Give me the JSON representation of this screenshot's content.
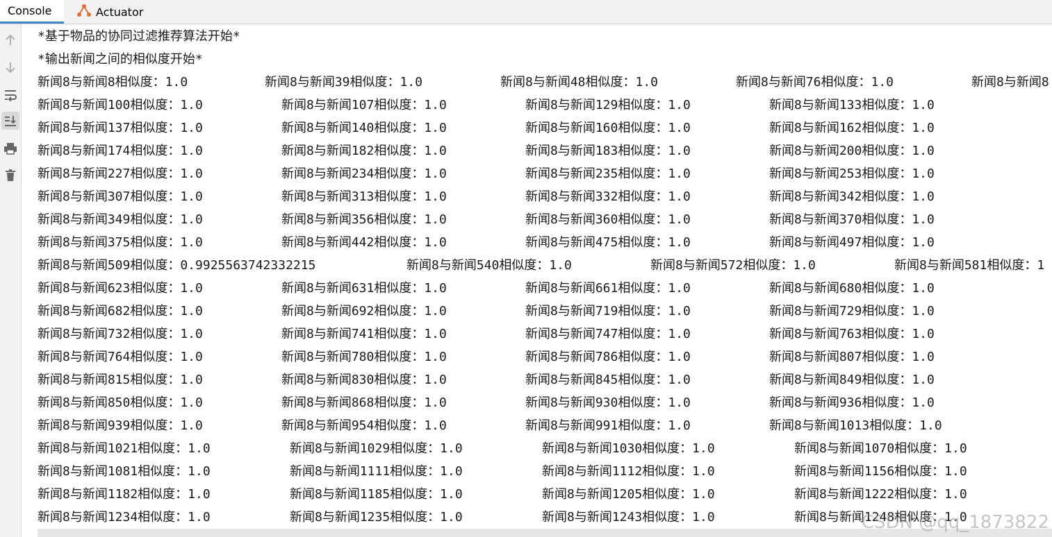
{
  "tabs": {
    "console": "Console",
    "actuator": "Actuator"
  },
  "toolbar_icons": [
    "arrow-up-icon",
    "arrow-down-icon",
    "soft-wrap-icon",
    "scroll-to-end-icon",
    "print-icon",
    "trash-icon"
  ],
  "header_lines": [
    "*基于物品的协同过滤推荐算法开始*",
    "*输出新闻之间的相似度开始*"
  ],
  "rows": [
    [
      "新闻8与新闻8相似度：1.0",
      "新闻8与新闻39相似度：1.0",
      "新闻8与新闻48相似度：1.0",
      "新闻8与新闻76相似度：1.0",
      "新闻8与新闻8"
    ],
    [
      "新闻8与新闻100相似度：1.0",
      "新闻8与新闻107相似度：1.0",
      "新闻8与新闻129相似度：1.0",
      "新闻8与新闻133相似度：1.0"
    ],
    [
      "新闻8与新闻137相似度：1.0",
      "新闻8与新闻140相似度：1.0",
      "新闻8与新闻160相似度：1.0",
      "新闻8与新闻162相似度：1.0"
    ],
    [
      "新闻8与新闻174相似度：1.0",
      "新闻8与新闻182相似度：1.0",
      "新闻8与新闻183相似度：1.0",
      "新闻8与新闻200相似度：1.0"
    ],
    [
      "新闻8与新闻227相似度：1.0",
      "新闻8与新闻234相似度：1.0",
      "新闻8与新闻235相似度：1.0",
      "新闻8与新闻253相似度：1.0"
    ],
    [
      "新闻8与新闻307相似度：1.0",
      "新闻8与新闻313相似度：1.0",
      "新闻8与新闻332相似度：1.0",
      "新闻8与新闻342相似度：1.0"
    ],
    [
      "新闻8与新闻349相似度：1.0",
      "新闻8与新闻356相似度：1.0",
      "新闻8与新闻360相似度：1.0",
      "新闻8与新闻370相似度：1.0"
    ],
    [
      "新闻8与新闻375相似度：1.0",
      "新闻8与新闻442相似度：1.0",
      "新闻8与新闻475相似度：1.0",
      "新闻8与新闻497相似度：1.0"
    ],
    [
      "新闻8与新闻509相似度：0.9925563742332215",
      "新闻8与新闻540相似度：1.0",
      "新闻8与新闻572相似度：1.0",
      "新闻8与新闻581相似度：1"
    ],
    [
      "新闻8与新闻623相似度：1.0",
      "新闻8与新闻631相似度：1.0",
      "新闻8与新闻661相似度：1.0",
      "新闻8与新闻680相似度：1.0"
    ],
    [
      "新闻8与新闻682相似度：1.0",
      "新闻8与新闻692相似度：1.0",
      "新闻8与新闻719相似度：1.0",
      "新闻8与新闻729相似度：1.0"
    ],
    [
      "新闻8与新闻732相似度：1.0",
      "新闻8与新闻741相似度：1.0",
      "新闻8与新闻747相似度：1.0",
      "新闻8与新闻763相似度：1.0"
    ],
    [
      "新闻8与新闻764相似度：1.0",
      "新闻8与新闻780相似度：1.0",
      "新闻8与新闻786相似度：1.0",
      "新闻8与新闻807相似度：1.0"
    ],
    [
      "新闻8与新闻815相似度：1.0",
      "新闻8与新闻830相似度：1.0",
      "新闻8与新闻845相似度：1.0",
      "新闻8与新闻849相似度：1.0"
    ],
    [
      "新闻8与新闻850相似度：1.0",
      "新闻8与新闻868相似度：1.0",
      "新闻8与新闻930相似度：1.0",
      "新闻8与新闻936相似度：1.0"
    ],
    [
      "新闻8与新闻939相似度：1.0",
      "新闻8与新闻954相似度：1.0",
      "新闻8与新闻991相似度：1.0",
      "新闻8与新闻1013相似度：1.0"
    ],
    [
      "新闻8与新闻1021相似度：1.0",
      "新闻8与新闻1029相似度：1.0",
      "新闻8与新闻1030相似度：1.0",
      "新闻8与新闻1070相似度：1.0"
    ],
    [
      "新闻8与新闻1081相似度：1.0",
      "新闻8与新闻1111相似度：1.0",
      "新闻8与新闻1112相似度：1.0",
      "新闻8与新闻1156相似度：1.0"
    ],
    [
      "新闻8与新闻1182相似度：1.0",
      "新闻8与新闻1185相似度：1.0",
      "新闻8与新闻1205相似度：1.0",
      "新闻8与新闻1222相似度：1.0"
    ],
    [
      "新闻8与新闻1234相似度：1.0",
      "新闻8与新闻1235相似度：1.0",
      "新闻8与新闻1243相似度：1.0",
      "新闻8与新闻1248相似度：1.0"
    ]
  ],
  "watermark": "CSDN @qq_1873822"
}
